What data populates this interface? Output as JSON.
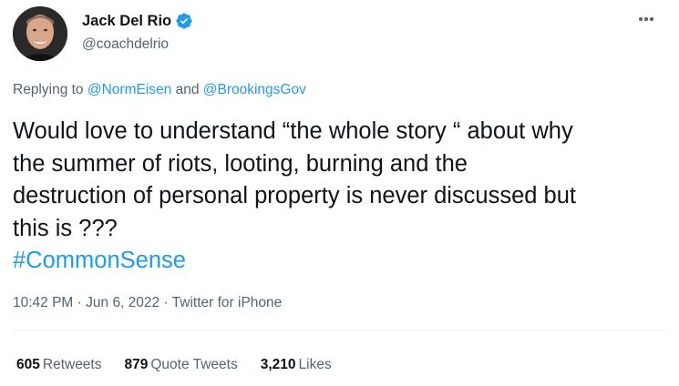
{
  "author": {
    "display_name": "Jack Del Rio",
    "handle": "@coachdelrio",
    "verified": true,
    "avatar_icon": "profile-photo-avatar"
  },
  "menu_icon": "more-options-icon",
  "reply": {
    "prefix": "Replying to ",
    "mention_1": "@NormEisen",
    "connector": " and ",
    "mention_2": "@BrookingsGov"
  },
  "tweet": {
    "lines": [
      "Would love to understand “the whole story “ about why",
      "the summer of riots, looting, burning and the",
      "destruction of personal property is never discussed but",
      "this is ???"
    ],
    "hashtag": "#CommonSense"
  },
  "meta": {
    "time": "10:42 PM",
    "sep1": " · ",
    "date": "Jun 6, 2022",
    "sep2": " · ",
    "source": "Twitter for iPhone"
  },
  "stats": {
    "retweets_count": "605",
    "retweets_label": "Retweets",
    "quotes_count": "879",
    "quotes_label": "Quote Tweets",
    "likes_count": "3,210",
    "likes_label": "Likes"
  },
  "colors": {
    "accent": "#1d9bf0",
    "secondary_text": "#536471",
    "primary_text": "#0f1419"
  }
}
